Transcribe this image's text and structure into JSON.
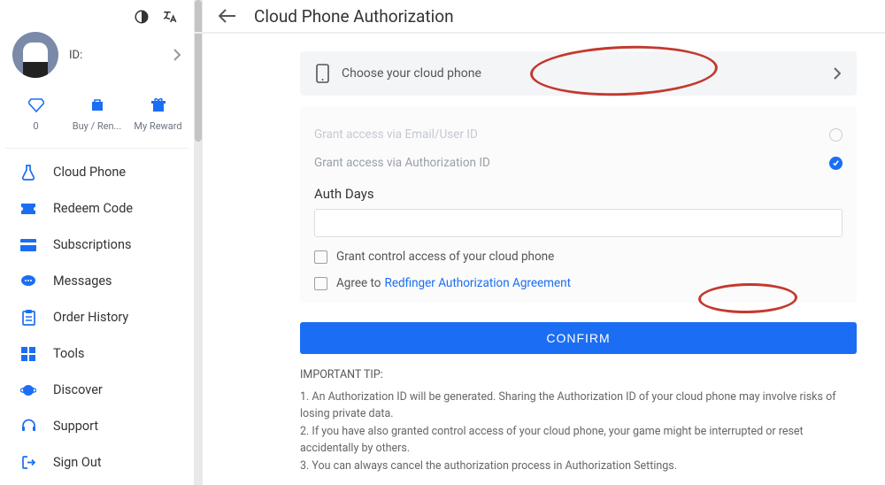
{
  "header": {
    "title": "Cloud Phone Authorization"
  },
  "sidebar": {
    "id_label": "ID:",
    "quick": {
      "diamond_count": "0",
      "buy_label": "Buy / Ren...",
      "reward_label": "My Reward"
    },
    "items": [
      {
        "label": "Cloud Phone"
      },
      {
        "label": "Redeem Code"
      },
      {
        "label": "Subscriptions"
      },
      {
        "label": "Messages"
      },
      {
        "label": "Order History"
      },
      {
        "label": "Tools"
      },
      {
        "label": "Discover"
      },
      {
        "label": "Support"
      },
      {
        "label": "Sign Out"
      }
    ]
  },
  "chooser": {
    "label": "Choose your cloud phone"
  },
  "options": {
    "email_label": "Grant access via Email/User ID",
    "authid_label": "Grant access via Authorization ID"
  },
  "auth_days_label": "Auth Days",
  "auth_days_value": "",
  "checkboxes": {
    "control_label": "Grant control access of your cloud phone",
    "agree_prefix": "Agree to",
    "agree_link": "Redfinger Authorization Agreement"
  },
  "confirm_label": "CONFIRM",
  "tip_title": "IMPORTANT TIP:",
  "tips": {
    "t1": "1. An Authorization ID will be generated. Sharing the Authorization ID of your cloud phone may involve risks of losing private data.",
    "t2": "2. If you have also granted control access of your cloud phone, your game might be interrupted or reset accidentally by others.",
    "t3": "3. You can always cancel the authorization process in Authorization Settings."
  }
}
